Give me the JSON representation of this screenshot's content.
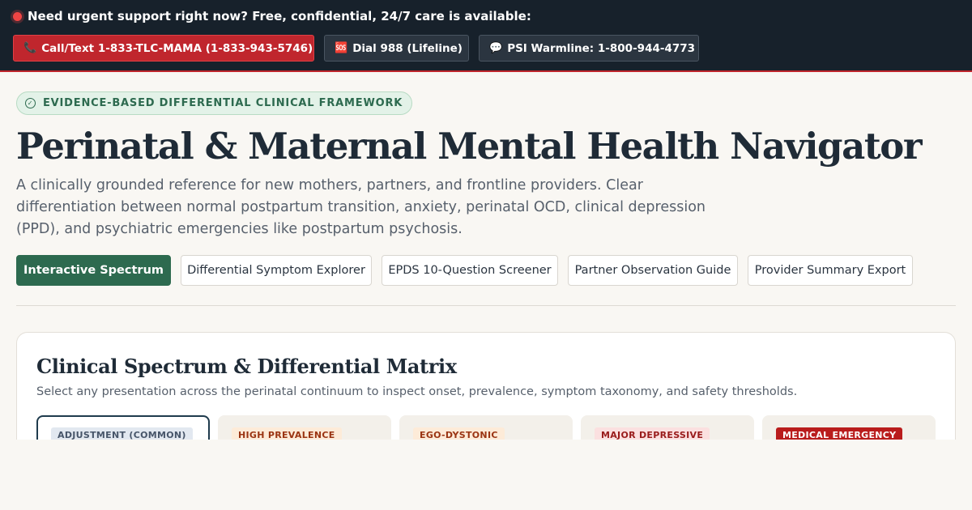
{
  "crisis": {
    "headline": "Need urgent support right now? Free, confidential, 24/7 care is available:",
    "buttons": [
      {
        "glyph": "📞",
        "icon": "phone-icon",
        "label": "Call/Text 1-833-TLC-MAMA (1-833-943-5746)"
      },
      {
        "glyph": "🆘",
        "icon": "sos-icon",
        "label": "Dial 988 (Lifeline)"
      },
      {
        "glyph": "💬",
        "icon": "speech-bubble-icon",
        "label": "PSI Warmline: 1-800-944-4773"
      }
    ]
  },
  "hero": {
    "badge": "EVIDENCE-BASED DIFFERENTIAL CLINICAL FRAMEWORK",
    "badge_icon": "check-circle-icon",
    "title": "Perinatal & Maternal Mental Health Navigator",
    "subtitle": "A clinically grounded reference for new mothers, partners, and frontline providers. Clear differentiation between normal postpartum transition, anxiety, perinatal OCD, clinical depression (PPD), and psychiatric emergencies like postpartum psychosis."
  },
  "tabs": [
    {
      "label": "Interactive Spectrum",
      "active": true
    },
    {
      "label": "Differential Symptom Explorer",
      "active": false
    },
    {
      "label": "EPDS 10-Question Screener",
      "active": false
    },
    {
      "label": "Partner Observation Guide",
      "active": false
    },
    {
      "label": "Provider Summary Export",
      "active": false
    }
  ],
  "spectrum": {
    "title": "Clinical Spectrum & Differential Matrix",
    "description": "Select any presentation across the perinatal continuum to inspect onset, prevalence, symptom taxonomy, and safety thresholds.",
    "tiles": [
      {
        "tag": "ADJUSTMENT (COMMON)",
        "selected": true
      },
      {
        "tag": "HIGH PREVALENCE",
        "selected": false
      },
      {
        "tag": "EGO-DYSTONIC",
        "selected": false
      },
      {
        "tag": "MAJOR DEPRESSIVE",
        "selected": false
      },
      {
        "tag": "MEDICAL EMERGENCY",
        "selected": false
      }
    ]
  },
  "colors": {
    "crisis_bg": "#17212b",
    "alert_red": "#c0262d",
    "brand_green": "#2d6a4f",
    "ink": "#1f2b37",
    "page_bg": "#f9f7f3"
  }
}
